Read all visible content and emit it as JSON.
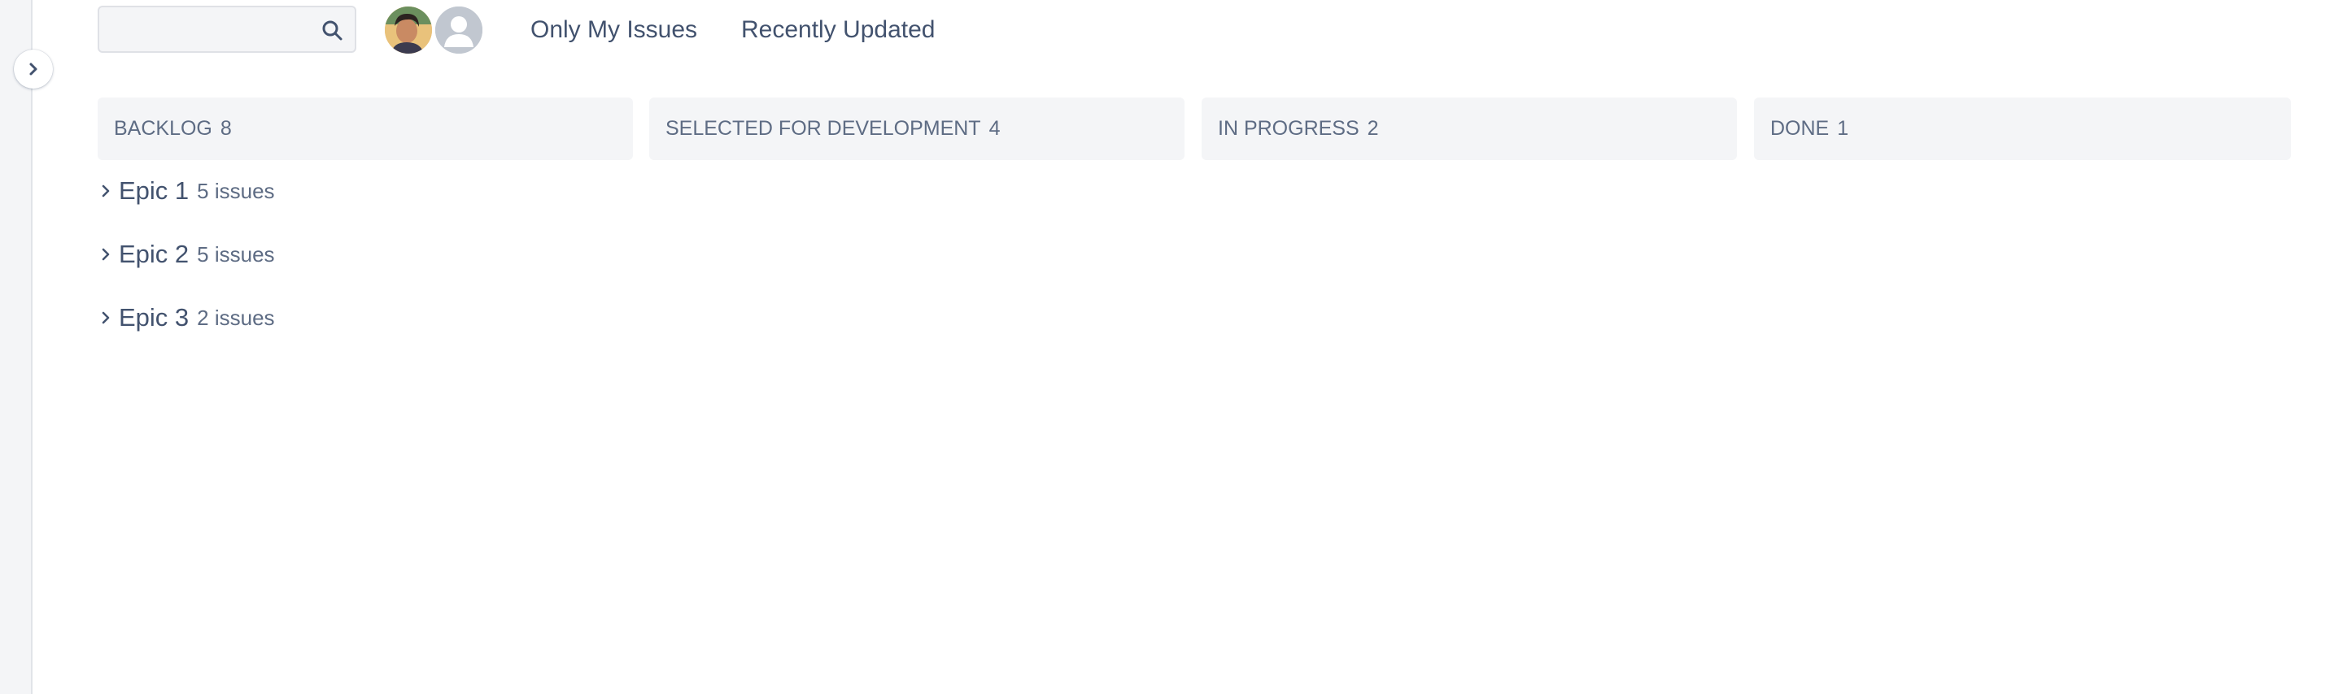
{
  "sidebar": {
    "expand_icon": "chevron-right-icon"
  },
  "toolbar": {
    "search": {
      "value": "",
      "placeholder": "",
      "icon": "search-icon"
    },
    "avatars": [
      {
        "name": "user-avatar-photo"
      },
      {
        "name": "unassigned-avatar"
      }
    ],
    "quick_filters": [
      {
        "label": "Only My Issues"
      },
      {
        "label": "Recently Updated"
      }
    ]
  },
  "columns": [
    {
      "title": "BACKLOG",
      "count": "8"
    },
    {
      "title": "SELECTED FOR DEVELOPMENT",
      "count": "4"
    },
    {
      "title": "IN PROGRESS",
      "count": "2"
    },
    {
      "title": "DONE",
      "count": "1"
    }
  ],
  "epics": [
    {
      "name": "Epic 1",
      "count_label": "5 issues"
    },
    {
      "name": "Epic 2",
      "count_label": "5 issues"
    },
    {
      "name": "Epic 3",
      "count_label": "2 issues"
    }
  ],
  "colors": {
    "text": "#42526e",
    "subtle_text": "#5e6c84",
    "header_bg": "#f4f5f7",
    "border": "#dfe1e6"
  }
}
